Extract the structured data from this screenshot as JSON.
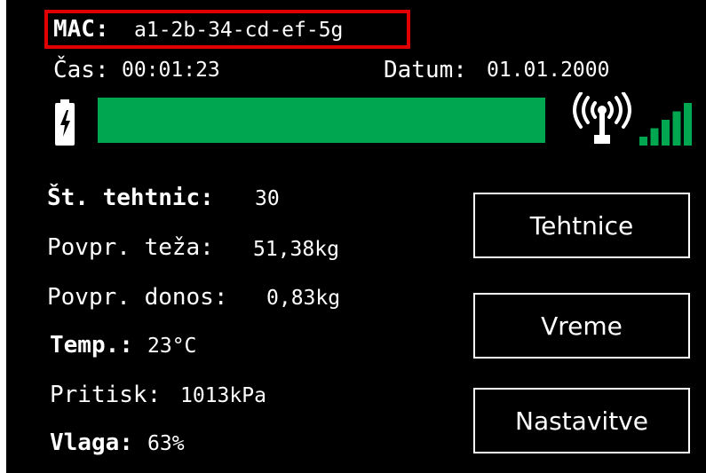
{
  "header": {
    "mac_label": "MAC:",
    "mac_value": "a1-2b-34-cd-ef-5g",
    "time_label": "Čas:",
    "time_value": "00:01:23",
    "date_label": "Datum:",
    "date_value": "01.01.2000"
  },
  "status": {
    "battery_icon": "battery-charging-icon",
    "level_fraction": 1.0,
    "bar_color": "#00a650",
    "antenna_icon": "antenna-icon",
    "signal_icon": "signal-strength-icon",
    "signal_bars": 5,
    "signal_color": "#00a650"
  },
  "readings": [
    {
      "label": "Št. tehtnic:",
      "value": "30"
    },
    {
      "label": "Povpr. teža:",
      "value": "51,38kg"
    },
    {
      "label": "Povpr. donos:",
      "value": "0,83kg"
    },
    {
      "label": "Temp.:",
      "value": "23°C"
    },
    {
      "label": "Pritisk:",
      "value": "1013kPa"
    },
    {
      "label": "Vlaga:",
      "value": "63%"
    }
  ],
  "buttons": {
    "tehtnice": "Tehtnice",
    "vreme": "Vreme",
    "nastavitve": "Nastavitve"
  }
}
